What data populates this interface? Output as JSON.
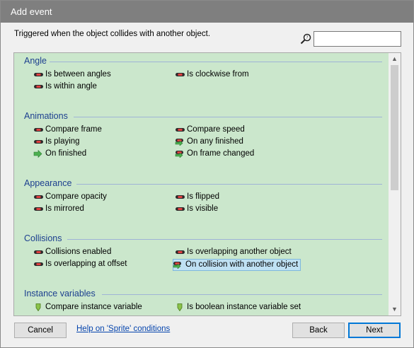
{
  "window": {
    "title": "Add event"
  },
  "description": "Triggered when the object collides with another object.",
  "search": {
    "value": "",
    "placeholder": ""
  },
  "groups": [
    {
      "title": "Angle",
      "items": [
        {
          "label": "Is between angles",
          "icon": "condition-icon"
        },
        {
          "label": "Is clockwise from",
          "icon": "condition-icon"
        },
        {
          "label": "Is within angle",
          "icon": "condition-icon"
        }
      ]
    },
    {
      "title": "Animations",
      "items": [
        {
          "label": "Compare frame",
          "icon": "condition-icon"
        },
        {
          "label": "Compare speed",
          "icon": "condition-icon"
        },
        {
          "label": "Is playing",
          "icon": "condition-icon"
        },
        {
          "label": "On any finished",
          "icon": "trigger-icon"
        },
        {
          "label": "On finished",
          "icon": "trigger-icon"
        },
        {
          "label": "On frame changed",
          "icon": "trigger-icon"
        }
      ]
    },
    {
      "title": "Appearance",
      "items": [
        {
          "label": "Compare opacity",
          "icon": "condition-icon"
        },
        {
          "label": "Is flipped",
          "icon": "condition-icon"
        },
        {
          "label": "Is mirrored",
          "icon": "condition-icon"
        },
        {
          "label": "Is visible",
          "icon": "condition-icon"
        }
      ]
    },
    {
      "title": "Collisions",
      "items": [
        {
          "label": "Collisions enabled",
          "icon": "condition-icon"
        },
        {
          "label": "Is overlapping another object",
          "icon": "condition-icon"
        },
        {
          "label": "Is overlapping at offset",
          "icon": "condition-icon"
        },
        {
          "label": "On collision with another object",
          "icon": "trigger-icon",
          "selected": true
        }
      ]
    },
    {
      "title": "Instance variables",
      "items": [
        {
          "label": "Compare instance variable",
          "icon": "variable-icon"
        },
        {
          "label": "Is boolean instance variable set",
          "icon": "variable-icon"
        }
      ]
    }
  ],
  "buttons": {
    "cancel": "Cancel",
    "help": "Help on 'Sprite' conditions",
    "back": "Back",
    "next": "Next"
  },
  "colors": {
    "titlebar": "#7f7f7f",
    "list_background": "#cbe7cc",
    "group_title": "#1c3f8f",
    "selection": "#bfe1f4",
    "default_button_border": "#0078d7"
  }
}
